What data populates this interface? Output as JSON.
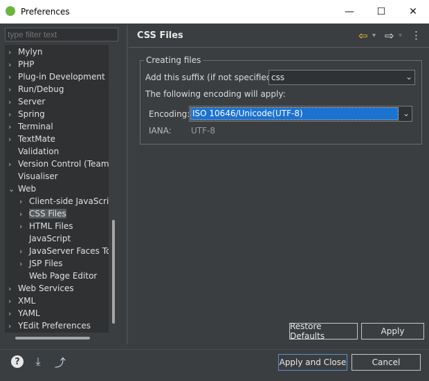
{
  "window": {
    "title": "Preferences",
    "minimize_glyph": "—",
    "maximize_glyph": "☐",
    "close_glyph": "✕"
  },
  "filter": {
    "placeholder": "type filter text"
  },
  "tree": {
    "items": [
      {
        "label": "Mylyn",
        "level": 0,
        "expander": "›"
      },
      {
        "label": "PHP",
        "level": 0,
        "expander": "›"
      },
      {
        "label": "Plug-in Development",
        "level": 0,
        "expander": "›"
      },
      {
        "label": "Run/Debug",
        "level": 0,
        "expander": "›"
      },
      {
        "label": "Server",
        "level": 0,
        "expander": "›"
      },
      {
        "label": "Spring",
        "level": 0,
        "expander": "›"
      },
      {
        "label": "Terminal",
        "level": 0,
        "expander": "›"
      },
      {
        "label": "TextMate",
        "level": 0,
        "expander": "›"
      },
      {
        "label": "Validation",
        "level": 0,
        "expander": ""
      },
      {
        "label": "Version Control (Team)",
        "level": 0,
        "expander": "›"
      },
      {
        "label": "Visualiser",
        "level": 0,
        "expander": ""
      },
      {
        "label": "Web",
        "level": 0,
        "expander": "⌄"
      },
      {
        "label": "Client-side JavaScript",
        "level": 1,
        "expander": "›"
      },
      {
        "label": "CSS Files",
        "level": 1,
        "expander": "›",
        "selected": true
      },
      {
        "label": "HTML Files",
        "level": 1,
        "expander": "›"
      },
      {
        "label": "JavaScript",
        "level": 1,
        "expander": ""
      },
      {
        "label": "JavaServer Faces Tools",
        "level": 1,
        "expander": "›"
      },
      {
        "label": "JSP Files",
        "level": 1,
        "expander": "›"
      },
      {
        "label": "Web Page Editor",
        "level": 1,
        "expander": ""
      },
      {
        "label": "Web Services",
        "level": 0,
        "expander": "›"
      },
      {
        "label": "XML",
        "level": 0,
        "expander": "›"
      },
      {
        "label": "YAML",
        "level": 0,
        "expander": "›"
      },
      {
        "label": "YEdit Preferences",
        "level": 0,
        "expander": "›"
      }
    ]
  },
  "page": {
    "title": "CSS Files",
    "back_glyph": "⇦",
    "forward_glyph": "⇨",
    "menu_glyph": "⋮",
    "dropdown_glyph": "▾"
  },
  "group": {
    "legend": "Creating files",
    "suffix_label": "Add this suffix (if not specified):",
    "suffix_value": "css",
    "encoding_note": "The following encoding will apply:",
    "encoding_label": "Encoding:",
    "encoding_value": "ISO 10646/Unicode(UTF-8)",
    "iana_label": "IANA:",
    "iana_value": "UTF-8",
    "combo_arrow": "⌄"
  },
  "buttons": {
    "restore_defaults": "Restore Defaults",
    "apply": "Apply",
    "apply_and_close": "Apply and Close",
    "cancel": "Cancel"
  },
  "footer": {
    "help_glyph": "?",
    "import_glyph": "⤓",
    "export_glyph": "⤴"
  },
  "colors": {
    "background": "#3b3e40",
    "selection": "#1b73d1",
    "forward_arrow": "#f2c230"
  }
}
